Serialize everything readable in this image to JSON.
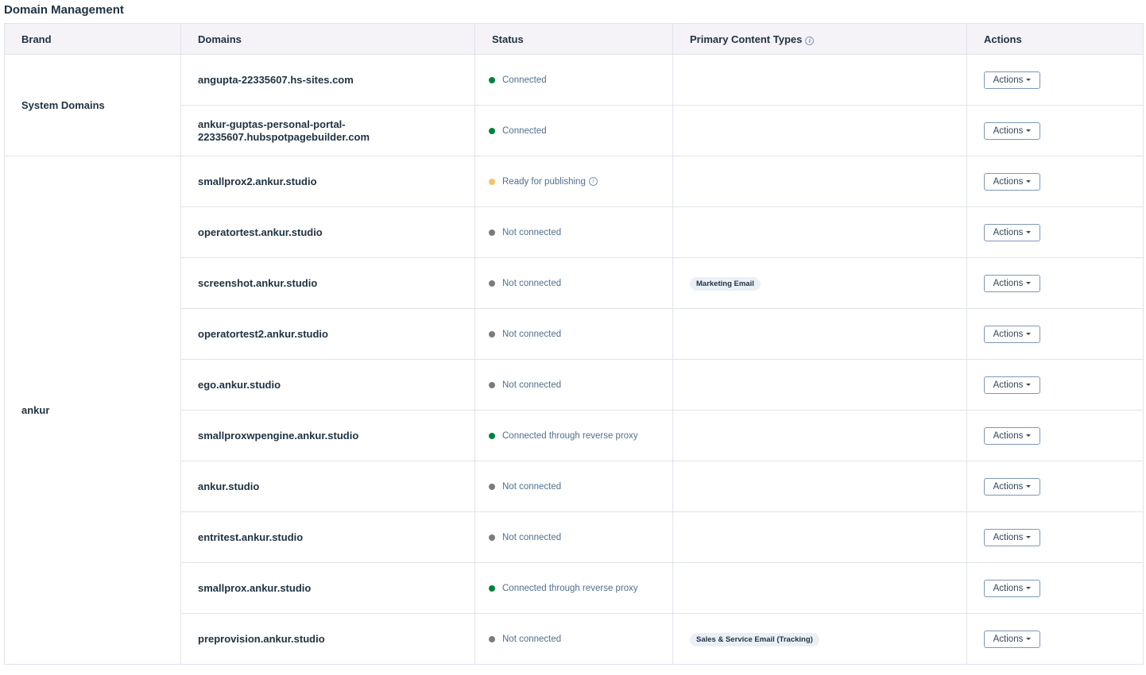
{
  "page": {
    "title": "Domain Management"
  },
  "colors": {
    "connected": "#00823f",
    "ready": "#f5c26b",
    "not_connected": "#7c7c7c",
    "header_bg": "#f5f2f8",
    "border": "#dfe3eb"
  },
  "table": {
    "headers": {
      "brand": "Brand",
      "domains": "Domains",
      "status": "Status",
      "content_types": "Primary Content Types",
      "actions": "Actions"
    },
    "groups": [
      {
        "brand": "System Domains",
        "rows": [
          {
            "domain": "angupta-22335607.hs-sites.com",
            "status": "Connected",
            "status_kind": "connected",
            "content_type": "",
            "action": "Actions"
          },
          {
            "domain": "ankur-guptas-personal-portal-\n22335607.hubspotpagebuilder.com",
            "status": "Connected",
            "status_kind": "connected",
            "content_type": "",
            "action": "Actions"
          }
        ]
      },
      {
        "brand": "ankur",
        "rows": [
          {
            "domain": "smallprox2.ankur.studio",
            "status": "Ready for publishing",
            "status_kind": "ready",
            "status_info": true,
            "content_type": "",
            "action": "Actions"
          },
          {
            "domain": "operatortest.ankur.studio",
            "status": "Not connected",
            "status_kind": "not_connected",
            "content_type": "",
            "action": "Actions"
          },
          {
            "domain": "screenshot.ankur.studio",
            "status": "Not connected",
            "status_kind": "not_connected",
            "content_type": "Marketing Email",
            "action": "Actions"
          },
          {
            "domain": "operatortest2.ankur.studio",
            "status": "Not connected",
            "status_kind": "not_connected",
            "content_type": "",
            "action": "Actions"
          },
          {
            "domain": "ego.ankur.studio",
            "status": "Not connected",
            "status_kind": "not_connected",
            "content_type": "",
            "action": "Actions"
          },
          {
            "domain": "smallproxwpengine.ankur.studio",
            "status": "Connected through reverse proxy",
            "status_kind": "connected",
            "content_type": "",
            "action": "Actions"
          },
          {
            "domain": "ankur.studio",
            "status": "Not connected",
            "status_kind": "not_connected",
            "content_type": "",
            "action": "Actions"
          },
          {
            "domain": "entritest.ankur.studio",
            "status": "Not connected",
            "status_kind": "not_connected",
            "content_type": "",
            "action": "Actions"
          },
          {
            "domain": "smallprox.ankur.studio",
            "status": "Connected through reverse proxy",
            "status_kind": "connected",
            "content_type": "",
            "action": "Actions"
          },
          {
            "domain": "preprovision.ankur.studio",
            "status": "Not connected",
            "status_kind": "not_connected",
            "content_type": "Sales & Service Email (Tracking)",
            "action": "Actions"
          }
        ]
      }
    ]
  }
}
